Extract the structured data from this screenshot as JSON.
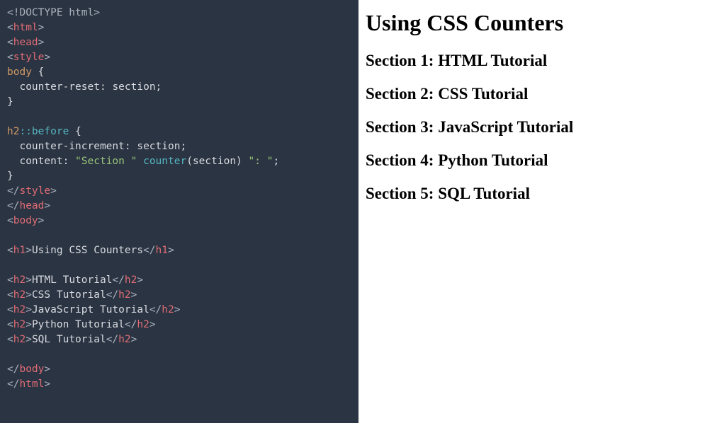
{
  "code": {
    "doctype": "<!DOCTYPE html>",
    "html_open": "html",
    "head_open": "head",
    "style_open": "style",
    "selector_body": "body",
    "rule1_prop": "counter-reset",
    "rule1_value": "section",
    "selector_h2": "h2",
    "pseudo_before": "::before",
    "rule2_prop": "counter-increment",
    "rule2_value": "section",
    "rule3_prop": "content",
    "rule3_str1": "\"Section \"",
    "rule3_func": "counter",
    "rule3_arg": "section",
    "rule3_str2": "\": \"",
    "style_close": "style",
    "head_close": "head",
    "body_open": "body",
    "h1_tag": "h1",
    "h1_text": "Using CSS Counters",
    "h2_tag": "h2",
    "h2_texts": {
      "t0": "HTML Tutorial",
      "t1": "CSS Tutorial",
      "t2": "JavaScript Tutorial",
      "t3": "Python Tutorial",
      "t4": "SQL Tutorial"
    },
    "body_close": "body",
    "html_close": "html"
  },
  "output": {
    "title": "Using CSS Counters",
    "prefix": "Section",
    "items": {
      "i0": "Section 1: HTML Tutorial",
      "i1": "Section 2: CSS Tutorial",
      "i2": "Section 3: JavaScript Tutorial",
      "i3": "Section 4: Python Tutorial",
      "i4": "Section 5: SQL Tutorial"
    }
  }
}
